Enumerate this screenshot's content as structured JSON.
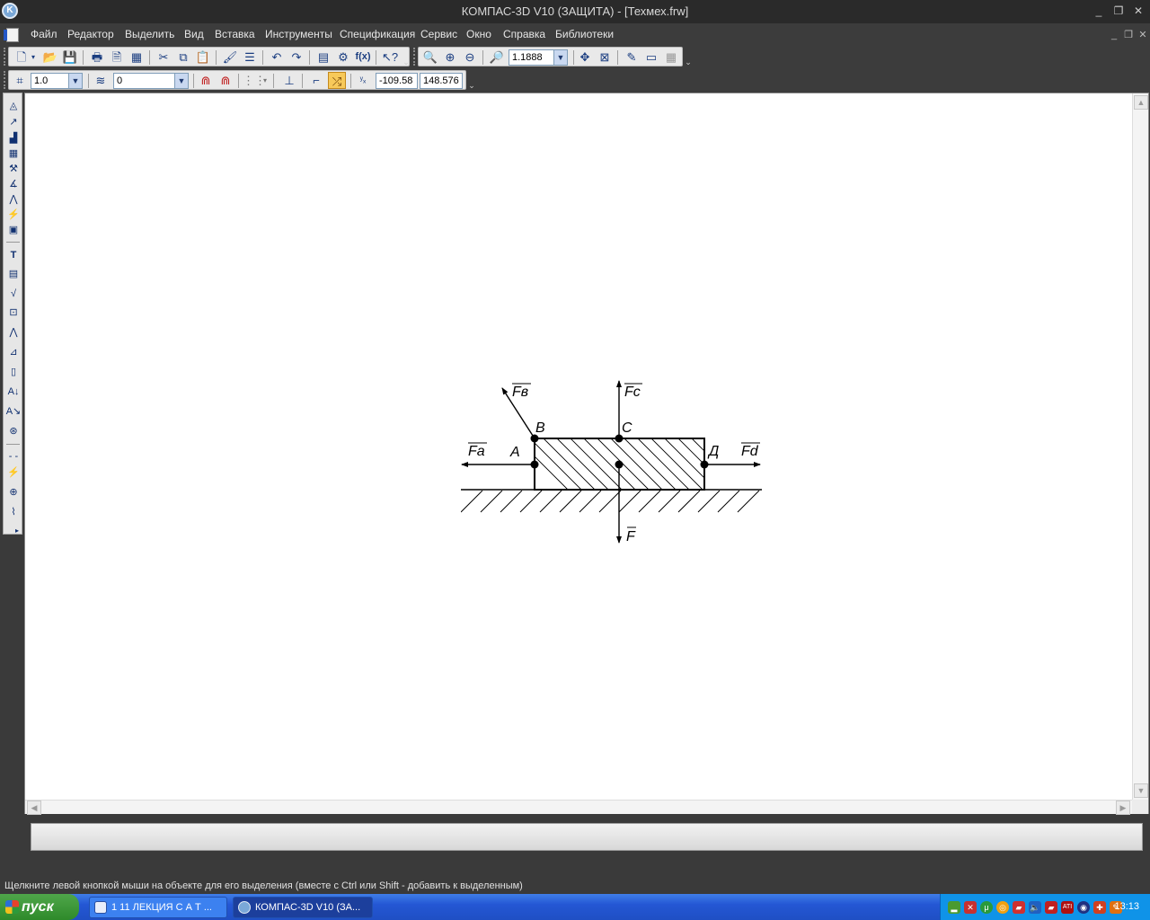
{
  "window": {
    "title": "КОМПАС-3D V10 (ЗАЩИТА) - [Техмех.frw]",
    "minimize": "_",
    "restore": "❐",
    "close": "✕"
  },
  "menu": {
    "items": [
      "Файл",
      "Редактор",
      "Выделить",
      "Вид",
      "Вставка",
      "Инструменты",
      "Спецификация",
      "Сервис",
      "Окно",
      "Справка",
      "Библиотеки"
    ]
  },
  "toolbar": {
    "zoom_value": "1.1888",
    "step_value": "1.0",
    "layer_value": "0",
    "coord_x": "-109.58",
    "coord_y": "148.576",
    "fx_label": "f(x)"
  },
  "drawing": {
    "labels": {
      "fb": "Fв",
      "fc": "Fc",
      "fa": "Fa",
      "fd": "Fd",
      "f": "F",
      "a": "А",
      "b": "В",
      "c": "С",
      "d": "Д"
    }
  },
  "status": {
    "hint": "Щелкните левой кнопкой мыши на объекте для его выделения (вместе с Ctrl или Shift - добавить к выделенным)"
  },
  "taskbar": {
    "start_label": "пуск",
    "tasks": [
      "1 11 ЛЕКЦИЯ С А Т ...",
      "КОМПАС-3D V10 (ЗА..."
    ],
    "clock": "13:13"
  },
  "colors": {
    "taskbar": "#2457d4",
    "start": "#2e8a2a",
    "tray": "#0f93e8",
    "active_tool": "#f7c95a"
  }
}
